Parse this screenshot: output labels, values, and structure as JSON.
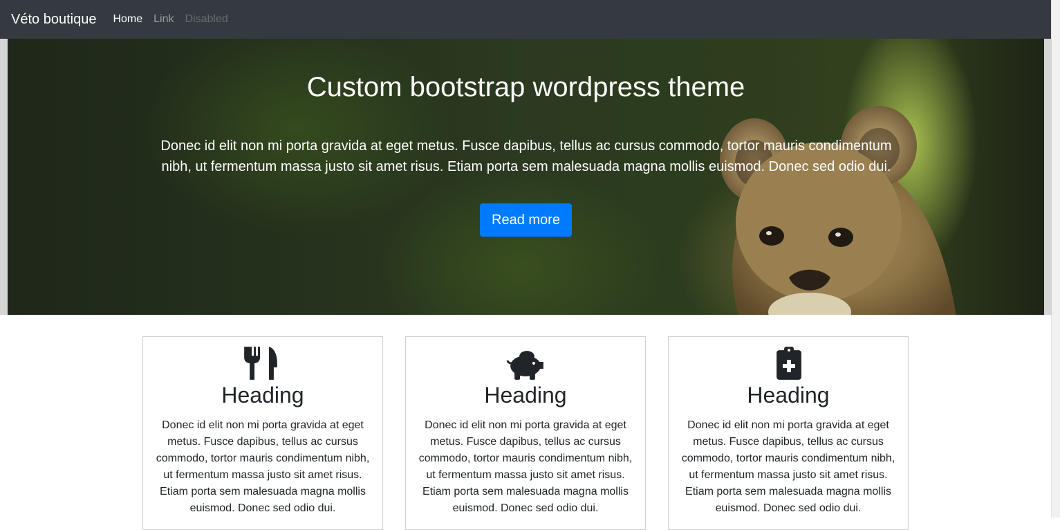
{
  "navbar": {
    "brand": "Véto boutique",
    "items": [
      {
        "label": "Home",
        "state": "active"
      },
      {
        "label": "Link",
        "state": "normal"
      },
      {
        "label": "Disabled",
        "state": "disabled"
      }
    ]
  },
  "hero": {
    "title": "Custom bootstrap wordpress theme",
    "text": "Donec id elit non mi porta gravida at eget metus. Fusce dapibus, tellus ac cursus commodo, tortor mauris condimentum nibh, ut fermentum massa justo sit amet risus. Etiam porta sem malesuada magna mollis euismod. Donec sed odio dui.",
    "button_label": "Read more",
    "button_color": "#007bff",
    "background": "lion-cub-photo"
  },
  "cards": [
    {
      "icon": "utensils-icon",
      "heading": "Heading",
      "text": "Donec id elit non mi porta gravida at eget metus. Fusce dapibus, tellus ac cursus commodo, tortor mauris condimentum nibh, ut fermentum massa justo sit amet risus. Etiam porta sem malesuada magna mollis euismod. Donec sed odio dui."
    },
    {
      "icon": "piggy-bank-icon",
      "heading": "Heading",
      "text": "Donec id elit non mi porta gravida at eget metus. Fusce dapibus, tellus ac cursus commodo, tortor mauris condimentum nibh, ut fermentum massa justo sit amet risus. Etiam porta sem malesuada magna mollis euismod. Donec sed odio dui."
    },
    {
      "icon": "clipboard-medical-icon",
      "heading": "Heading",
      "text": "Donec id elit non mi porta gravida at eget metus. Fusce dapibus, tellus ac cursus commodo, tortor mauris condimentum nibh, ut fermentum massa justo sit amet risus. Etiam porta sem malesuada magna mollis euismod. Donec sed odio dui."
    }
  ],
  "colors": {
    "navbar_bg": "#343a40",
    "text": "#212529",
    "primary": "#007bff"
  }
}
